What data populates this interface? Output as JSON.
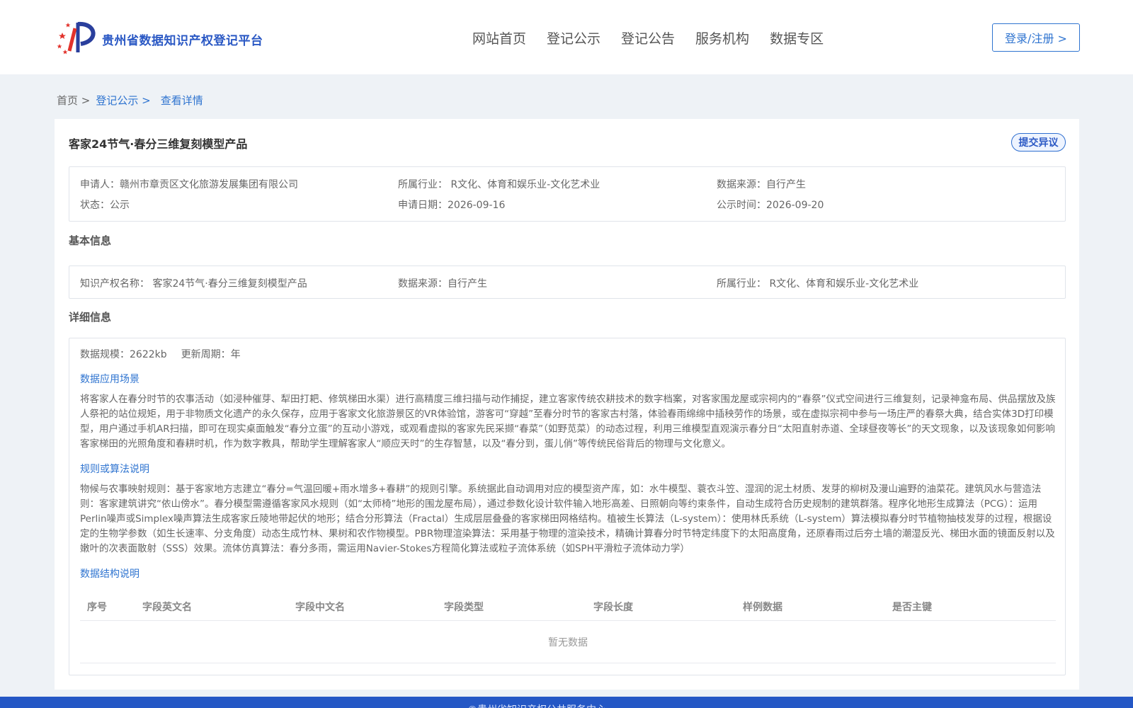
{
  "header": {
    "brand": "贵州省数据知识产权登记平台",
    "nav": [
      "网站首页",
      "登记公示",
      "登记公告",
      "服务机构",
      "数据专区"
    ],
    "login": "登录/注册 >",
    "logo_colors": {
      "red": "#e2322b",
      "blue": "#2a3f9d"
    }
  },
  "breadcrumb": {
    "home": "首页 >",
    "level1": "登记公示 >",
    "current": "查看详情"
  },
  "detail": {
    "title": "客家24节气·春分三维复刻模型产品",
    "objection_button": "提交异议",
    "summary": {
      "applicant": "申请人：赣州市章贡区文化旅游发展集团有限公司",
      "industry": "所属行业： R文化、体育和娱乐业-文化艺术业",
      "source": "数据来源：自行产生",
      "status": "状态：公示",
      "apply_date": "申请日期：2026-09-16",
      "publish_date": "公示时间：2026-09-20"
    },
    "basic": {
      "section_title": "基本信息",
      "ip_name": "知识产权名称： 客家24节气·春分三维复刻模型产品",
      "source": "数据来源：自行产生",
      "industry": "所属行业： R文化、体育和娱乐业-文化艺术业"
    },
    "info": {
      "section_title": "详细信息",
      "scale": "数据规模：2622kb",
      "cycle": "更新周期：年",
      "scenario_title": "数据应用场景",
      "scenario_text": "将客家人在春分时节的农事活动（如浸种催芽、犁田打耙、修筑梯田水渠）进行高精度三维扫描与动作捕捉，建立客家传统农耕技术的数字档案，对客家围龙屋或宗祠内的“春祭”仪式空间进行三维复刻，记录神龛布局、供品摆放及族人祭祀的站位规矩，用于非物质文化遗产的永久保存，应用于客家文化旅游景区的VR体验馆，游客可“穿越”至春分时节的客家古村落，体验春雨绵绵中插秧劳作的场景，或在虚拟宗祠中参与一场庄严的春祭大典，结合实体3D打印模型，用户通过手机AR扫描，即可在现实桌面触发“春分立蛋”的互动小游戏，或观看虚拟的客家先民采撷“春菜”（如野苋菜）的动态过程，利用三维模型直观演示春分日“太阳直射赤道、全球昼夜等长”的天文现象，以及该现象如何影响客家梯田的光照角度和春耕时机，作为数字教具，帮助学生理解客家人“顺应天时”的生存智慧，以及“春分到，蛋儿俏”等传统民俗背后的物理与文化意义。",
      "rule_title": "规则或算法说明",
      "rule_text": "物候与农事映射规则：基于客家地方志建立“春分=气温回暖+雨水增多+春耕”的规则引擎。系统据此自动调用对应的模型资产库，如：水牛模型、蓑衣斗笠、湿润的泥土材质、发芽的柳树及漫山遍野的油菜花。建筑风水与营造法则：客家建筑讲究“依山傍水”。春分模型需遵循客家风水规则（如“太师椅”地形的围龙屋布局），通过参数化设计软件输入地形高差、日照朝向等约束条件，自动生成符合历史规制的建筑群落。程序化地形生成算法（PCG）：运用Perlin噪声或Simplex噪声算法生成客家丘陵地带起伏的地形；结合分形算法（Fractal）生成层层叠叠的客家梯田网格结构。植被生长算法（L-system）：使用林氏系统（L-system）算法模拟春分时节植物抽枝发芽的过程，根据设定的生物学参数（如生长速率、分支角度）动态生成竹林、果树和农作物模型。PBR物理渲染算法：采用基于物理的渲染技术，精确计算春分时节特定纬度下的太阳高度角，还原春雨过后夯土墙的潮湿反光、梯田水面的镜面反射以及嫩叶的次表面散射（SSS）效果。流体仿真算法：春分多雨，需运用Navier-Stokes方程简化算法或粒子流体系统（如SPH平滑粒子流体动力学）",
      "structure_title": "数据结构说明",
      "table_headers": [
        "序号",
        "字段英文名",
        "字段中文名",
        "字段类型",
        "字段长度",
        "样例数据",
        "是否主键"
      ],
      "empty_text": "暂无数据"
    }
  },
  "footer": {
    "text": "©贵州省知识产权公共服务中心"
  }
}
